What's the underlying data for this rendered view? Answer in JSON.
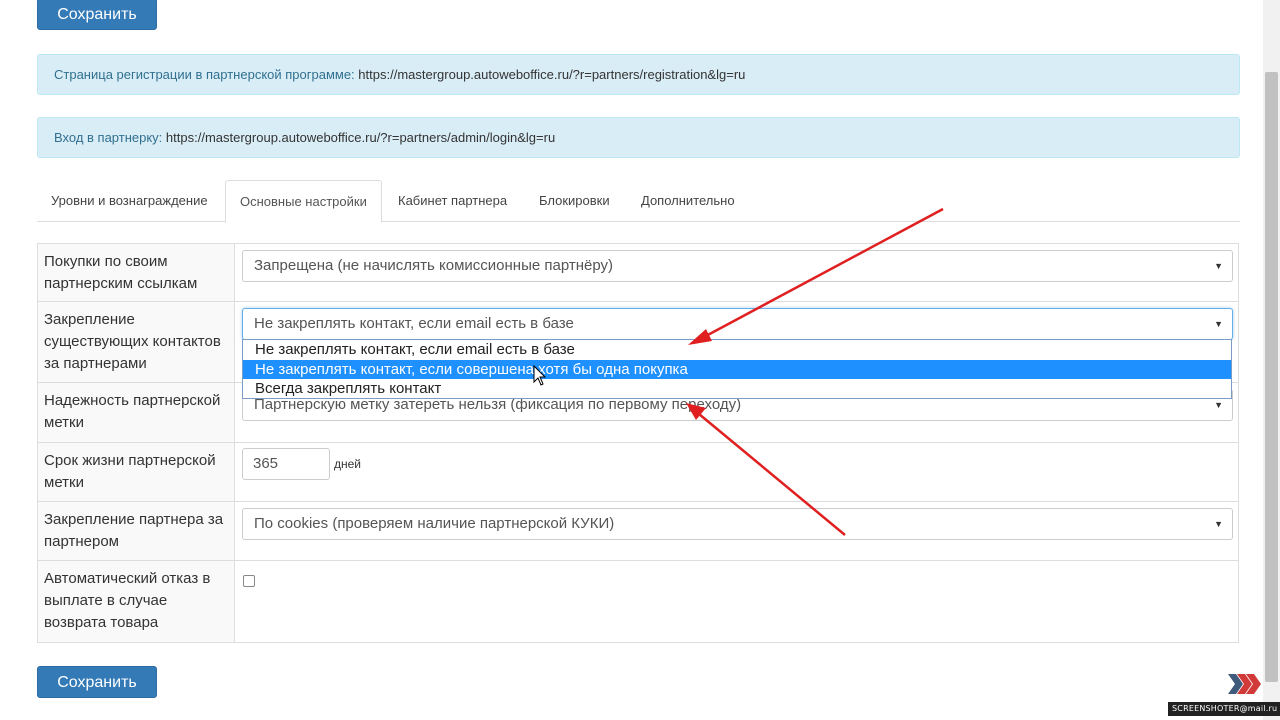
{
  "buttons": {
    "save_top": "Сохранить",
    "save_bottom": "Сохранить"
  },
  "alerts": {
    "registration": {
      "label": "Страница регистрации в партнерской программе:",
      "url": "https://mastergroup.autoweboffice.ru/?r=partners/registration&lg=ru"
    },
    "login": {
      "label": "Вход в партнерку:",
      "url": "https://mastergroup.autoweboffice.ru/?r=partners/admin/login&lg=ru"
    }
  },
  "tabs": [
    {
      "label": "Уровни и вознаграждение"
    },
    {
      "label": "Основные настройки",
      "active": true
    },
    {
      "label": "Кабинет партнера"
    },
    {
      "label": "Блокировки"
    },
    {
      "label": "Дополнительно"
    }
  ],
  "settings": {
    "own_links": {
      "label": "Покупки по своим партнерским ссылкам",
      "value": "Запрещена (не начислять комиссионные партнёру)"
    },
    "pin_existing": {
      "label": "Закрепление существующих контактов за партнерами",
      "value": "Не закреплять контакт, если email есть в базе",
      "options": [
        "Не закреплять контакт, если email есть в базе",
        "Не закреплять контакт, если совершена хотя бы одна покупка",
        "Всегда закреплять контакт"
      ],
      "highlighted_index": 1
    },
    "reliability": {
      "label": "Надежность партнерской метки",
      "value": "Партнерскую метку затереть нельзя (фиксация по первому переходу)"
    },
    "lifetime": {
      "label": "Срок жизни партнерской метки",
      "value": "365",
      "unit": "дней"
    },
    "partner_pin": {
      "label": "Закрепление партнера за партнером",
      "value": "По cookies (проверяем наличие партнерской КУКИ)"
    },
    "auto_refuse": {
      "label": "Автоматический отказ в выплате в случае возврата товара",
      "checked": false
    }
  },
  "watermark": "SCREENSHOTER@mail.ru",
  "colors": {
    "primary": "#337ab7",
    "alert_bg": "#d9edf7",
    "alert_label": "#31708f",
    "highlight": "#1e90ff",
    "annotation_arrow": "#e02020"
  },
  "icons": {
    "caret": "caret-down-icon",
    "logo": "chevrons-right-icon"
  }
}
